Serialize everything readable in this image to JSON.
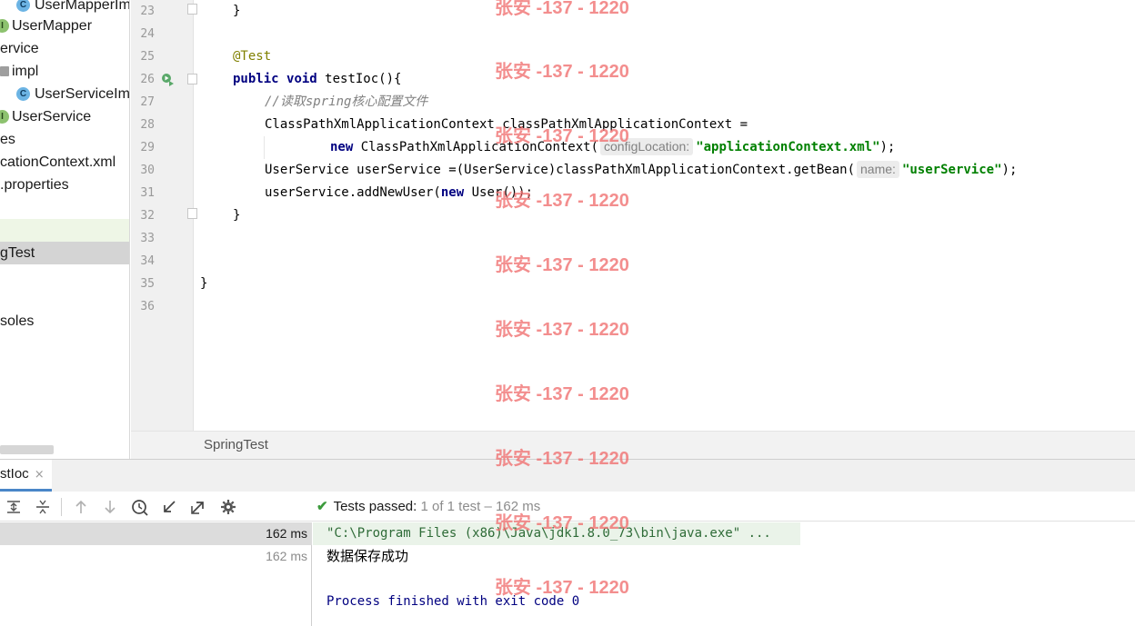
{
  "project_tree": {
    "items": [
      {
        "label": "UserMapperIm",
        "icon": "class-icon"
      },
      {
        "label": "UserMapper",
        "icon": "interface-icon"
      },
      {
        "label": "ervice",
        "icon": ""
      },
      {
        "label": "impl",
        "icon": "folder-icon"
      },
      {
        "label": "UserServiceIm",
        "icon": "class-icon"
      },
      {
        "label": "UserService",
        "icon": "interface-icon"
      },
      {
        "label": "es",
        "icon": ""
      },
      {
        "label": "cationContext.xml",
        "icon": ""
      },
      {
        "label": ".properties",
        "icon": ""
      },
      {
        "label": "",
        "icon": ""
      },
      {
        "label": "gTest",
        "icon": ""
      },
      {
        "label": "soles",
        "icon": ""
      }
    ]
  },
  "editor": {
    "line_numbers": [
      "23",
      "24",
      "25",
      "26",
      "27",
      "28",
      "29",
      "30",
      "31",
      "32",
      "33",
      "34",
      "35",
      "36"
    ],
    "line23": "}",
    "line25_annotation": "@Test",
    "line26_kw1": "public",
    "line26_kw2": "void",
    "line26_rest": " testIoc(){",
    "line27_comment": "//读取spring核心配置文件",
    "line28": "ClassPathXmlApplicationContext classPathXmlApplicationContext =",
    "line29_kw": "new",
    "line29_call": " ClassPathXmlApplicationContext(",
    "line29_hint": "configLocation:",
    "line29_str": "\"applicationContext.xml\"",
    "line29_end": ");",
    "line30_pre": "UserService userService =(UserService)classPathXmlApplicationContext.getBean(",
    "line30_hint": "name:",
    "line30_str": "\"userService\"",
    "line30_end": ");",
    "line31_pre": "userService.addNewUser(",
    "line31_kw": "new",
    "line31_post": " User());",
    "line32": "}",
    "line35": "}"
  },
  "breadcrumb": {
    "label": "SpringTest"
  },
  "run_window": {
    "tab_label": "stIoc",
    "tab_close": "×",
    "status_main": "Tests passed:",
    "status_count": " 1",
    "status_detail": " of 1 test – 162 ms",
    "results": [
      {
        "ms": "162 ms"
      },
      {
        "ms": "162 ms"
      }
    ],
    "console": {
      "cmd": "\"C:\\Program Files (x86)\\Java\\jdk1.8.0_73\\bin\\java.exe\" ...",
      "output": "数据保存成功",
      "exit": "Process finished with exit code 0"
    }
  },
  "watermark": {
    "text": "张安 -137 - 1220"
  },
  "colors": {
    "accent": "#4a86c8",
    "success": "#3b9a3b",
    "keyword": "#000080",
    "string": "#008000",
    "watermark": "#f06e6e"
  }
}
